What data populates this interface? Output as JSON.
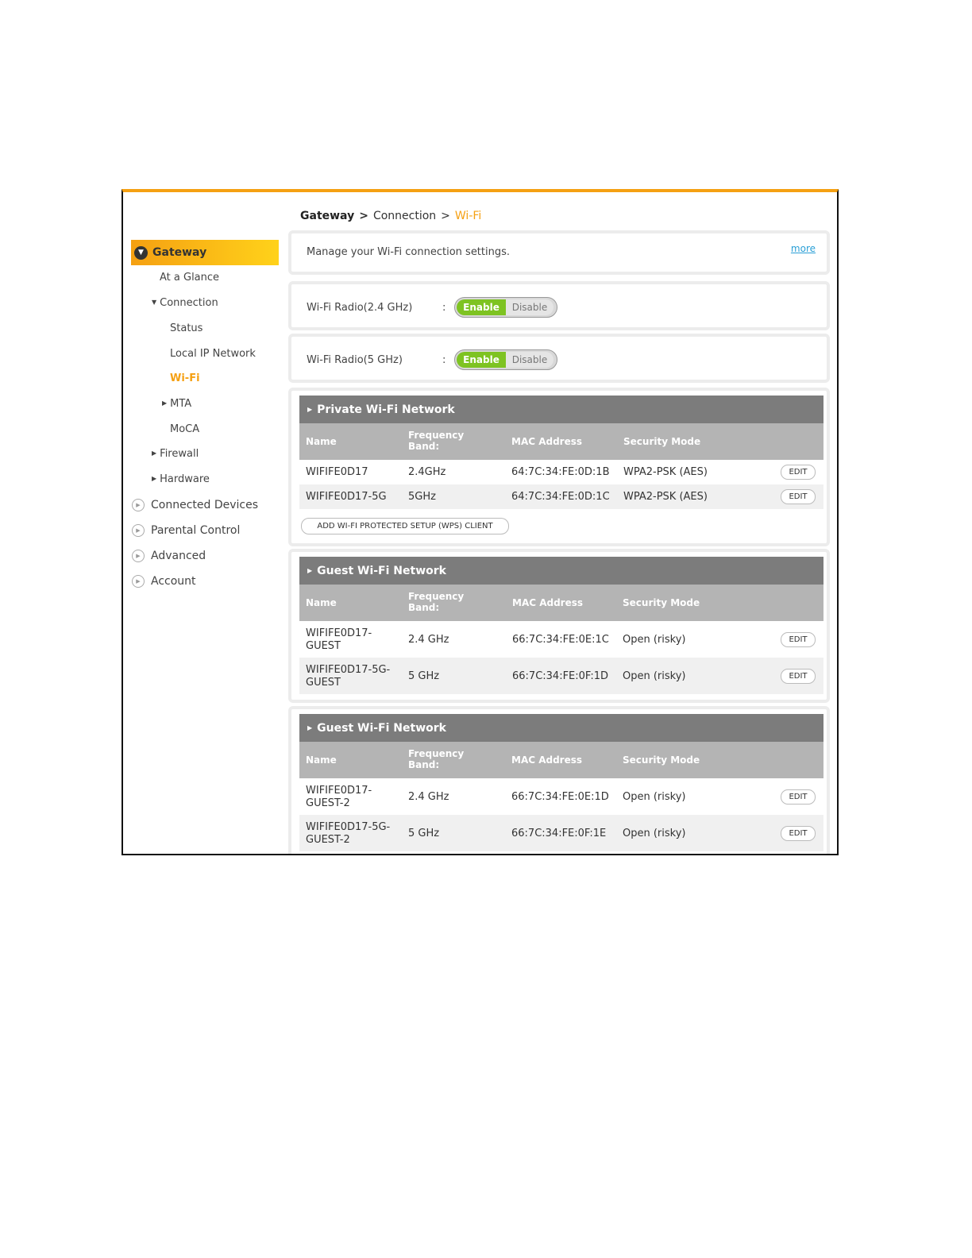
{
  "breadcrumb": {
    "root": "Gateway",
    "sep1": ">",
    "mid": "Connection",
    "sep2": ">",
    "current": "Wi-Fi"
  },
  "sidebar": {
    "gateway": "Gateway",
    "at_a_glance": "At a Glance",
    "connection": "Connection",
    "status": "Status",
    "local_ip": "Local IP Network",
    "wifi": "Wi-Fi",
    "mta": "MTA",
    "moca": "MoCA",
    "firewall": "Firewall",
    "hardware": "Hardware",
    "connected_devices": "Connected Devices",
    "parental_control": "Parental Control",
    "advanced": "Advanced",
    "account": "Account"
  },
  "intro": {
    "text": "Manage your Wi-Fi connection settings.",
    "more": "more"
  },
  "radios": [
    {
      "label": "Wi-Fi Radio(2.4 GHz)",
      "colon": ":",
      "enable": "Enable",
      "disable": "Disable"
    },
    {
      "label": "Wi-Fi Radio(5 GHz)",
      "colon": ":",
      "enable": "Enable",
      "disable": "Disable"
    }
  ],
  "columns": {
    "name": "Name",
    "freq1": "Frequency",
    "freq2": "Band:",
    "mac": "MAC Address",
    "security": "Security Mode"
  },
  "edit_label": "EDIT",
  "private_network": {
    "title": "Private Wi-Fi Network",
    "rows": [
      {
        "name": "WIFIFE0D17",
        "freq": "2.4GHz",
        "mac": "64:7C:34:FE:0D:1B",
        "security": "WPA2-PSK (AES)"
      },
      {
        "name": "WIFIFE0D17-5G",
        "freq": "5GHz",
        "mac": "64:7C:34:FE:0D:1C",
        "security": "WPA2-PSK (AES)"
      }
    ],
    "wps_button": "ADD WI-FI PROTECTED SETUP (WPS) CLIENT"
  },
  "guest_network_1": {
    "title": "Guest Wi-Fi Network",
    "rows": [
      {
        "name1": "WIFIFE0D17-",
        "name2": "GUEST",
        "freq": "2.4 GHz",
        "mac": "66:7C:34:FE:0E:1C",
        "security": "Open (risky)"
      },
      {
        "name1": "WIFIFE0D17-5G-",
        "name2": "GUEST",
        "freq": "5 GHz",
        "mac": "66:7C:34:FE:0F:1D",
        "security": "Open (risky)"
      }
    ]
  },
  "guest_network_2": {
    "title": "Guest Wi-Fi Network",
    "rows": [
      {
        "name1": "WIFIFE0D17-",
        "name2": "GUEST-2",
        "freq": "2.4 GHz",
        "mac": "66:7C:34:FE:0E:1D",
        "security": "Open (risky)"
      },
      {
        "name1": "WIFIFE0D17-5G-",
        "name2": "GUEST-2",
        "freq": "5 GHz",
        "mac": "66:7C:34:FE:0F:1E",
        "security": "Open (risky)"
      }
    ]
  }
}
